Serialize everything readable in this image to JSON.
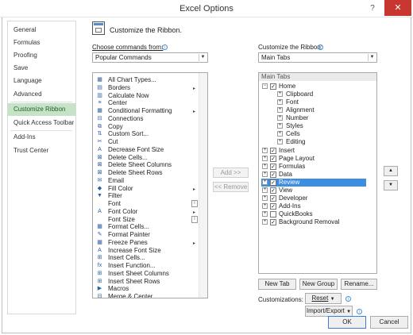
{
  "window": {
    "title": "Excel Options",
    "help_glyph": "?",
    "close_glyph": "✕"
  },
  "nav": {
    "items": [
      "General",
      "Formulas",
      "Proofing",
      "Save",
      "Language",
      "Advanced",
      "Customize Ribbon",
      "Quick Access Toolbar",
      "Add-Ins",
      "Trust Center"
    ],
    "selected": "Customize Ribbon"
  },
  "header": {
    "title": "Customize the Ribbon."
  },
  "left": {
    "choose_label": "Choose commands from:",
    "choose_value": "Popular Commands",
    "commands": [
      {
        "label": "All Chart Types...",
        "icon": "▦"
      },
      {
        "label": "Borders",
        "icon": "▤",
        "sub": "▸"
      },
      {
        "label": "Calculate Now",
        "icon": "▥"
      },
      {
        "label": "Center",
        "icon": "≡"
      },
      {
        "label": "Conditional Formatting",
        "icon": "▦",
        "sub": "▸"
      },
      {
        "label": "Connections",
        "icon": "⊟"
      },
      {
        "label": "Copy",
        "icon": "⧉"
      },
      {
        "label": "Custom Sort...",
        "icon": "⇅"
      },
      {
        "label": "Cut",
        "icon": "✂"
      },
      {
        "label": "Decrease Font Size",
        "icon": "A"
      },
      {
        "label": "Delete Cells...",
        "icon": "⊠"
      },
      {
        "label": "Delete Sheet Columns",
        "icon": "⊠"
      },
      {
        "label": "Delete Sheet Rows",
        "icon": "⊠"
      },
      {
        "label": "Email",
        "icon": "✉"
      },
      {
        "label": "Fill Color",
        "icon": "◆",
        "sub": "▸"
      },
      {
        "label": "Filter",
        "icon": "▼"
      },
      {
        "label": "Font",
        "icon": "",
        "gbox": "I"
      },
      {
        "label": "Font Color",
        "icon": "A",
        "sub": "▸"
      },
      {
        "label": "Font Size",
        "icon": "",
        "gbox": "I"
      },
      {
        "label": "Format Cells...",
        "icon": "▦"
      },
      {
        "label": "Format Painter",
        "icon": "✎"
      },
      {
        "label": "Freeze Panes",
        "icon": "▦",
        "sub": "▸"
      },
      {
        "label": "Increase Font Size",
        "icon": "A"
      },
      {
        "label": "Insert Cells...",
        "icon": "⊞"
      },
      {
        "label": "Insert Function...",
        "icon": "fx"
      },
      {
        "label": "Insert Sheet Columns",
        "icon": "⊞"
      },
      {
        "label": "Insert Sheet Rows",
        "icon": "⊞"
      },
      {
        "label": "Macros",
        "icon": "▶"
      },
      {
        "label": "Merge & Center",
        "icon": "⊟"
      }
    ]
  },
  "middle": {
    "add": "Add >>",
    "remove": "<< Remove"
  },
  "right": {
    "customize_label": "Customize the Ribbon:",
    "customize_value": "Main Tabs",
    "header": "Main Tabs",
    "tabs": [
      {
        "label": "Home",
        "expanded": true,
        "checked": true
      },
      {
        "label": "Clipboard",
        "group": true
      },
      {
        "label": "Font",
        "group": true
      },
      {
        "label": "Alignment",
        "group": true
      },
      {
        "label": "Number",
        "group": true
      },
      {
        "label": "Styles",
        "group": true
      },
      {
        "label": "Cells",
        "group": true
      },
      {
        "label": "Editing",
        "group": true
      },
      {
        "label": "Insert",
        "checked": true
      },
      {
        "label": "Page Layout",
        "checked": true
      },
      {
        "label": "Formulas",
        "checked": true
      },
      {
        "label": "Data",
        "checked": true
      },
      {
        "label": "Review",
        "checked": true,
        "selected": true
      },
      {
        "label": "View",
        "checked": true
      },
      {
        "label": "Developer",
        "checked": true
      },
      {
        "label": "Add-Ins",
        "checked": true
      },
      {
        "label": "QuickBooks",
        "checked": false
      },
      {
        "label": "Background Removal",
        "checked": true
      }
    ],
    "new_tab": "New Tab",
    "new_group": "New Group",
    "rename": "Rename...",
    "customizations_label": "Customizations:",
    "reset": "Reset",
    "import_export": "Import/Export"
  },
  "footer": {
    "ok": "OK",
    "cancel": "Cancel"
  }
}
